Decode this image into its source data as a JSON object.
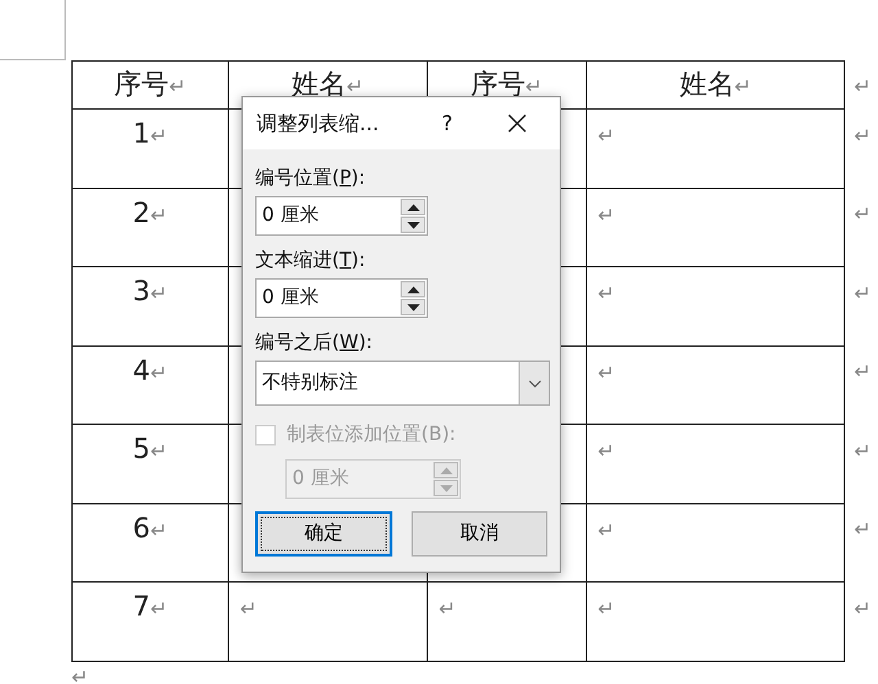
{
  "table": {
    "rows": [
      {
        "cells": [
          {
            "text": "序号",
            "mark": "↵"
          },
          {
            "text": "姓名",
            "mark": "↵"
          },
          {
            "text": "序号",
            "mark": "↵"
          },
          {
            "text": "姓名",
            "mark": "↵"
          }
        ],
        "end_mark": "↵",
        "kind": "header"
      },
      {
        "cells": [
          {
            "text": "1",
            "mark": "↵"
          },
          null,
          null,
          {
            "mark": "↵"
          }
        ],
        "end_mark": "↵",
        "kind": "body"
      },
      {
        "cells": [
          {
            "text": "2",
            "mark": "↵"
          },
          null,
          null,
          {
            "mark": "↵"
          }
        ],
        "end_mark": "↵",
        "kind": "body"
      },
      {
        "cells": [
          {
            "text": "3",
            "mark": "↵"
          },
          null,
          null,
          {
            "mark": "↵"
          }
        ],
        "end_mark": "↵",
        "kind": "body"
      },
      {
        "cells": [
          {
            "text": "4",
            "mark": "↵"
          },
          null,
          null,
          {
            "mark": "↵"
          }
        ],
        "end_mark": "↵",
        "kind": "body"
      },
      {
        "cells": [
          {
            "text": "5",
            "mark": "↵"
          },
          null,
          null,
          {
            "mark": "↵"
          }
        ],
        "end_mark": "↵",
        "kind": "body"
      },
      {
        "cells": [
          {
            "text": "6",
            "mark": "↵"
          },
          null,
          null,
          {
            "mark": "↵"
          }
        ],
        "end_mark": "↵",
        "kind": "body"
      },
      {
        "cells": [
          {
            "text": "7",
            "mark": "↵"
          },
          {
            "mark": "↵"
          },
          {
            "mark": "↵"
          },
          {
            "mark": "↵"
          }
        ],
        "end_mark": "↵",
        "kind": "body"
      }
    ]
  },
  "paragraph_mark": "↵",
  "dialog": {
    "title": "调整列表缩...",
    "help": "?",
    "fields": [
      {
        "kind": "spinner",
        "label_before": "编号位置(",
        "access_key": "P",
        "label_after": "):",
        "value": "0 厘米",
        "disabled": false
      },
      {
        "kind": "spinner",
        "label_before": "文本缩进(",
        "access_key": "T",
        "label_after": "):",
        "value": "0 厘米",
        "disabled": false
      },
      {
        "kind": "dropdown",
        "label_before": "编号之后(",
        "access_key": "W",
        "label_after": "):",
        "value": "不特别标注"
      },
      {
        "kind": "checkbox",
        "label": "制表位添加位置(B):",
        "checked": false,
        "disabled": true
      },
      {
        "kind": "spinner",
        "value": "0 厘米",
        "disabled": true
      }
    ],
    "buttons": [
      {
        "label": "确定",
        "default": true
      },
      {
        "label": "取消",
        "default": false
      }
    ]
  }
}
